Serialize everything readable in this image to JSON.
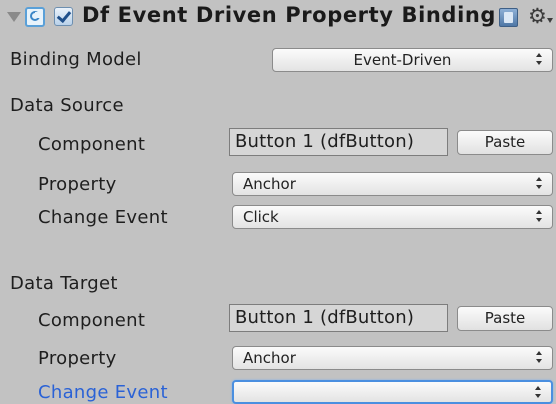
{
  "header": {
    "title": "Df Event Driven Property Binding",
    "enabled": true,
    "icons": [
      "foldout-arrow-icon",
      "script-icon",
      "checkbox-icon",
      "help-icon",
      "gear-icon"
    ]
  },
  "binding_model": {
    "label": "Binding Model",
    "value": "Event-Driven"
  },
  "data_source": {
    "section_label": "Data Source",
    "component_label": "Component",
    "component_value": "Button 1 (dfButton)",
    "paste_label": "Paste",
    "property_label": "Property",
    "property_value": "Anchor",
    "change_event_label": "Change Event",
    "change_event_value": "Click"
  },
  "data_target": {
    "section_label": "Data Target",
    "component_label": "Component",
    "component_value": "Button 1 (dfButton)",
    "paste_label": "Paste",
    "property_label": "Property",
    "property_value": "Anchor",
    "change_event_label": "Change Event",
    "change_event_value": ""
  },
  "colors": {
    "background": "#c2c2c2",
    "focus_label": "#2a62d6",
    "focus_border": "#4a8fe0"
  }
}
